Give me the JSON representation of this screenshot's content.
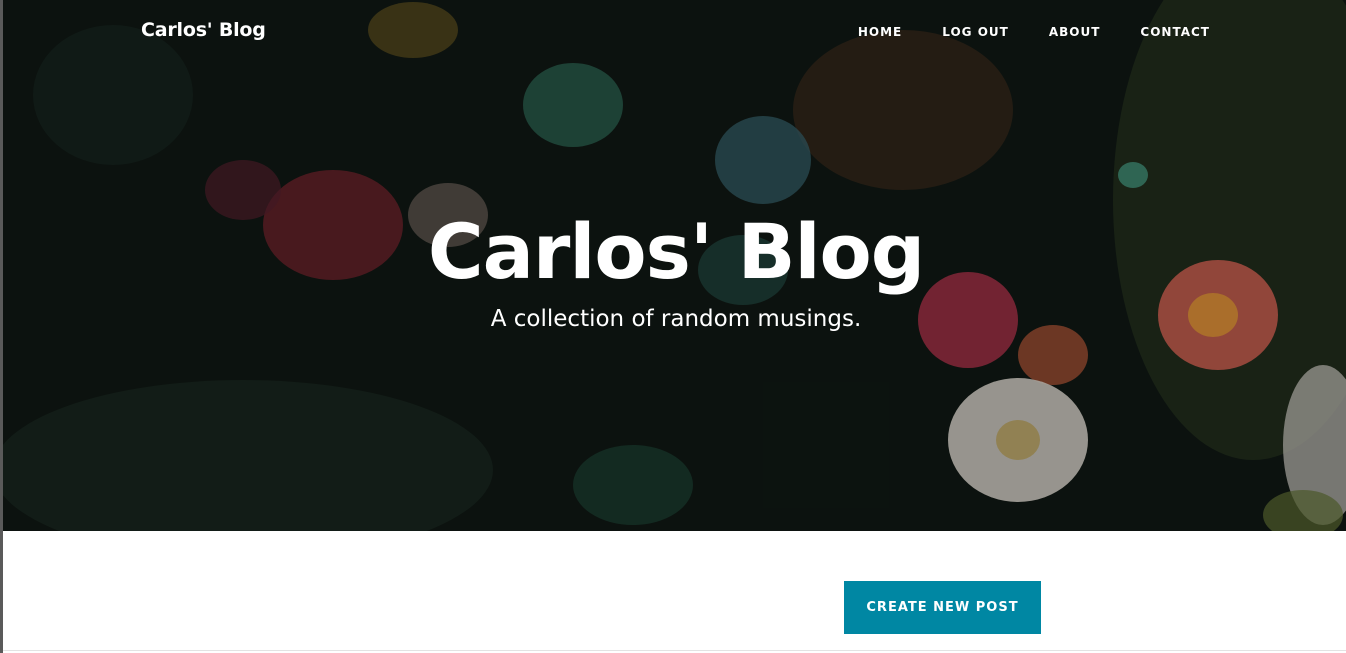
{
  "navbar": {
    "brand": "Carlos' Blog",
    "links": [
      "HOME",
      "LOG OUT",
      "ABOUT",
      "CONTACT"
    ]
  },
  "hero": {
    "title": "Carlos' Blog",
    "subtitle": "A collection of random musings."
  },
  "main": {
    "create_button_label": "CREATE NEW POST"
  },
  "colors": {
    "button_background": "#0087a3",
    "hero_background": "#0f1713",
    "text_light": "#ffffff"
  }
}
